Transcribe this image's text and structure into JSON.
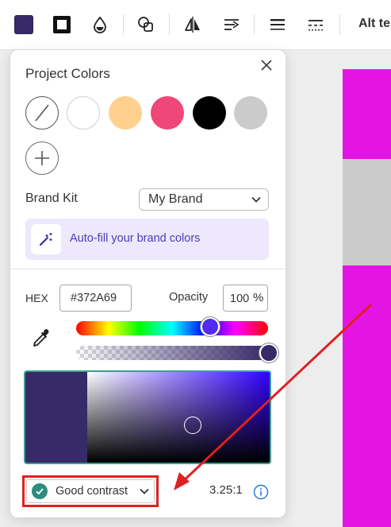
{
  "colors": {
    "selected": "#372A69",
    "canvas_magenta": "#E414E4",
    "canvas_gray": "#CBCBCB",
    "accent_teal": "#2E8B7F",
    "annotation_red": "#E02020",
    "link_purple": "#4B3BB8"
  },
  "toolbar": {
    "items": [
      {
        "icon": "fill-color-swatch-icon"
      },
      {
        "icon": "border-style-icon"
      },
      {
        "icon": "transparency-drop-icon"
      },
      {
        "icon": "shape-overlap-icon"
      },
      {
        "icon": "flip-icon"
      },
      {
        "icon": "align-icon"
      },
      {
        "icon": "line-weight-icon"
      },
      {
        "icon": "dash-style-icon"
      }
    ],
    "alt_text_label": "Alt te"
  },
  "panel": {
    "project_colors_title": "Project Colors",
    "swatches": [
      {
        "color": "none",
        "name": "no-color"
      },
      {
        "color": "#FFFFFF",
        "name": "white"
      },
      {
        "color": "#FFD08E",
        "name": "peach"
      },
      {
        "color": "#EE4778",
        "name": "pink"
      },
      {
        "color": "#000000",
        "name": "black"
      },
      {
        "color": "#CBCBCB",
        "name": "gray"
      }
    ],
    "brand_kit_label": "Brand Kit",
    "brand_select_value": "My Brand",
    "autofill_label": "Auto-fill your brand colors",
    "hex_label": "HEX",
    "hex_value": "#372A69",
    "opacity_label": "Opacity",
    "opacity_value": "100",
    "opacity_unit": "%",
    "hue_position": 0.7,
    "alpha_position": 1.0,
    "saturation": 0.58,
    "brightness": 0.41,
    "contrast_label": "Good contrast",
    "contrast_ratio": "3.25:1"
  }
}
